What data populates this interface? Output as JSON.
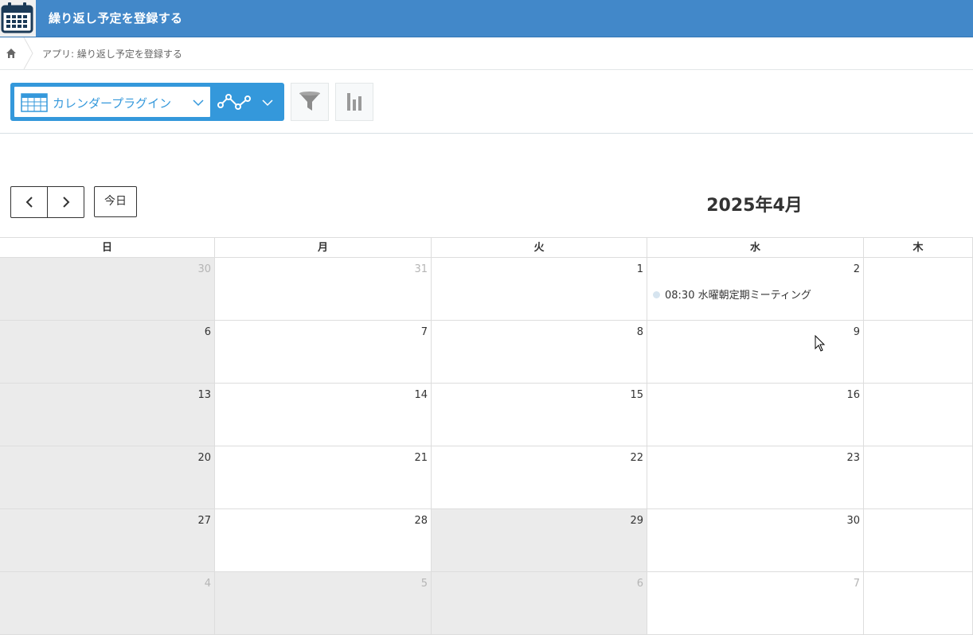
{
  "app": {
    "title": "繰り返し予定を登録する"
  },
  "breadcrumb": {
    "text": "アプリ: 繰り返し予定を登録する"
  },
  "toolbar": {
    "view_name": "カレンダープラグイン"
  },
  "calendar": {
    "today_label": "今日",
    "month_title": "2025年4月",
    "weekdays": [
      "日",
      "月",
      "火",
      "水",
      "木"
    ],
    "weeks": [
      [
        {
          "d": "30",
          "other": true
        },
        {
          "d": "31",
          "other": true
        },
        {
          "d": "1"
        },
        {
          "d": "2",
          "event": "08:30 水曜朝定期ミーティング"
        },
        {
          "d": ""
        }
      ],
      [
        {
          "d": "6"
        },
        {
          "d": "7"
        },
        {
          "d": "8"
        },
        {
          "d": "9"
        },
        {
          "d": ""
        }
      ],
      [
        {
          "d": "13"
        },
        {
          "d": "14"
        },
        {
          "d": "15"
        },
        {
          "d": "16"
        },
        {
          "d": ""
        }
      ],
      [
        {
          "d": "20"
        },
        {
          "d": "21"
        },
        {
          "d": "22"
        },
        {
          "d": "23"
        },
        {
          "d": ""
        }
      ],
      [
        {
          "d": "27"
        },
        {
          "d": "28"
        },
        {
          "d": "29",
          "shade": true
        },
        {
          "d": "30"
        },
        {
          "d": ""
        }
      ],
      [
        {
          "d": "4",
          "other": true
        },
        {
          "d": "5",
          "other": true,
          "shade": true
        },
        {
          "d": "6",
          "other": true,
          "shade": true
        },
        {
          "d": "7",
          "other": true
        },
        {
          "d": ""
        }
      ]
    ]
  },
  "icons": {
    "app": "calendar-icon",
    "home": "home-icon",
    "view": "table-icon",
    "graph": "line-graph-icon",
    "filter": "funnel-icon",
    "chart": "bar-chart-icon"
  },
  "colors": {
    "header": "#4288c9",
    "accent": "#3498db",
    "weekend_shade": "#ebebeb",
    "event_dot": "#d6e4ef"
  }
}
